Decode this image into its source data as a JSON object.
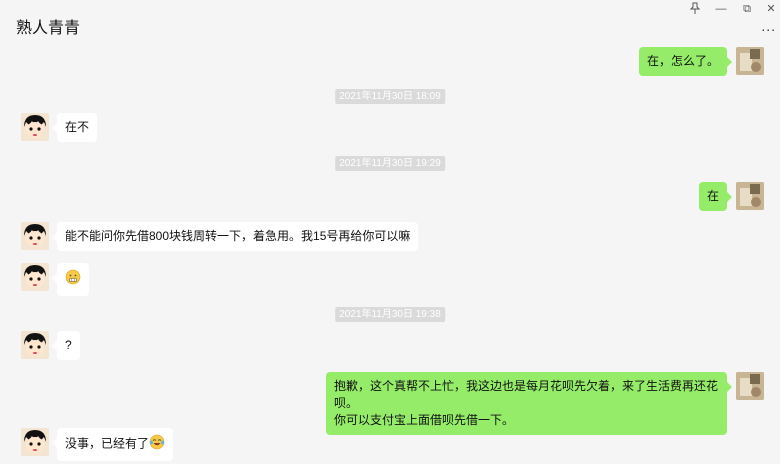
{
  "header": {
    "title": "熟人青青",
    "more_label": "...",
    "pin_icon": "pin-icon",
    "minimize_label": "—",
    "maximize_label": "⧉",
    "close_label": "✕"
  },
  "messages": {
    "m1": {
      "text": "在，怎么了。"
    },
    "ts1": {
      "text": "2021年11月30日 18:09"
    },
    "m2": {
      "text": "在不"
    },
    "ts2": {
      "text": "2021年11月30日 19:29"
    },
    "m3": {
      "text": "在"
    },
    "m4": {
      "text": "能不能问你先借800块钱周转一下，着急用。我15号再给你可以嘛"
    },
    "m5": {
      "emoji": "grimace-emoji"
    },
    "ts3": {
      "text": "2021年11月30日 19:38"
    },
    "m6": {
      "text": "?"
    },
    "m7": {
      "text_line1": "抱歉，这个真帮不上忙，我这边也是每月花呗先欠着，来了生活费再还花呗。",
      "text_line2": "你可以支付宝上面借呗先借一下。"
    },
    "m8": {
      "text": "没事，已经有了",
      "emoji": "tears-of-joy-emoji"
    }
  },
  "colors": {
    "background": "#f5f5f5",
    "my_bubble": "#95ec69",
    "other_bubble": "#ffffff",
    "timestamp_bg": "#dadada"
  }
}
